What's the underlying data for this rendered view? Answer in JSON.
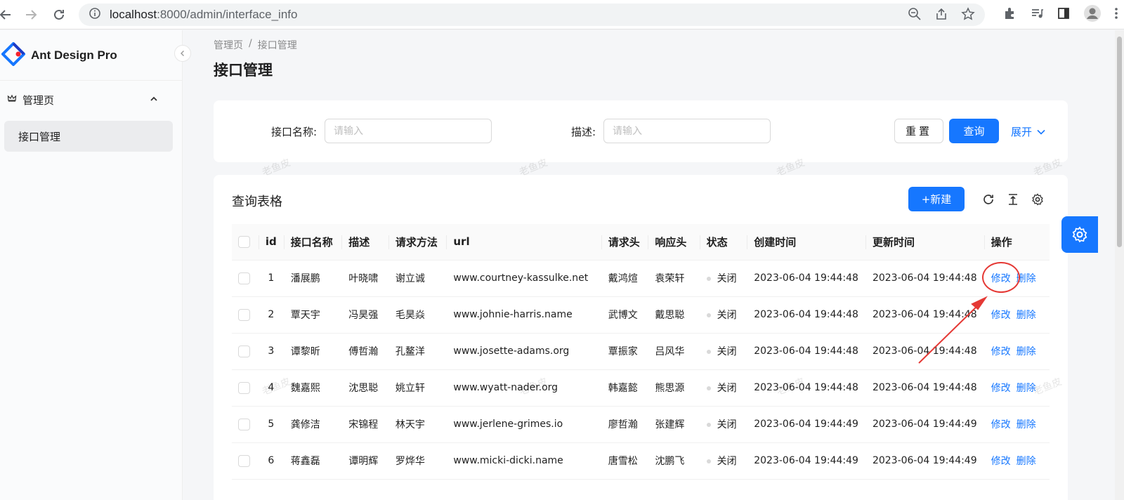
{
  "browser": {
    "url_host": "localhost",
    "url_path": ":8000/admin/interface_info"
  },
  "sidebar": {
    "logo_text": "Ant Design Pro",
    "group_label": "管理页",
    "items": [
      {
        "label": "接口管理"
      }
    ]
  },
  "breadcrumb": {
    "items": [
      "管理页",
      "接口管理"
    ],
    "separator": "/"
  },
  "page_title": "接口管理",
  "search": {
    "name_label": "接口名称:",
    "name_placeholder": "请输入",
    "desc_label": "描述:",
    "desc_placeholder": "请输入",
    "reset_label": "重置",
    "query_label": "查询",
    "expand_label": "展开"
  },
  "table": {
    "title": "查询表格",
    "new_label": "+新建",
    "columns": [
      "id",
      "接口名称",
      "描述",
      "请求方法",
      "url",
      "请求头",
      "响应头",
      "状态",
      "创建时间",
      "更新时间",
      "操作"
    ],
    "rows": [
      {
        "id": "1",
        "name": "潘展鹏",
        "desc": "叶晓啸",
        "method": "谢立诚",
        "url": "www.courtney-kassulke.net",
        "req": "戴鸿煊",
        "resp": "袁荣轩",
        "status": "关闭",
        "created": "2023-06-04 19:44:48",
        "updated": "2023-06-04 19:44:48",
        "edit": "修改",
        "del": "删除"
      },
      {
        "id": "2",
        "name": "覃天宇",
        "desc": "冯昊强",
        "method": "毛昊焱",
        "url": "www.johnie-harris.name",
        "req": "武博文",
        "resp": "戴思聪",
        "status": "关闭",
        "created": "2023-06-04 19:44:48",
        "updated": "2023-06-04 19:44:48",
        "edit": "修改",
        "del": "删除"
      },
      {
        "id": "3",
        "name": "谭黎昕",
        "desc": "傅哲瀚",
        "method": "孔鳌洋",
        "url": "www.josette-adams.org",
        "req": "覃振家",
        "resp": "吕风华",
        "status": "关闭",
        "created": "2023-06-04 19:44:48",
        "updated": "2023-06-04 19:44:48",
        "edit": "修改",
        "del": "删除"
      },
      {
        "id": "4",
        "name": "魏嘉熙",
        "desc": "沈思聪",
        "method": "姚立轩",
        "url": "www.wyatt-nader.org",
        "req": "韩嘉懿",
        "resp": "熊思源",
        "status": "关闭",
        "created": "2023-06-04 19:44:48",
        "updated": "2023-06-04 19:44:48",
        "edit": "修改",
        "del": "删除"
      },
      {
        "id": "5",
        "name": "龚修洁",
        "desc": "宋锦程",
        "method": "林天宇",
        "url": "www.jerlene-grimes.io",
        "req": "廖哲瀚",
        "resp": "张建辉",
        "status": "关闭",
        "created": "2023-06-04 19:44:49",
        "updated": "2023-06-04 19:44:49",
        "edit": "修改",
        "del": "删除"
      },
      {
        "id": "6",
        "name": "蒋鑫磊",
        "desc": "谭明辉",
        "method": "罗烨华",
        "url": "www.micki-dicki.name",
        "req": "唐雪松",
        "resp": "沈鹏飞",
        "status": "关闭",
        "created": "2023-06-04 19:44:49",
        "updated": "2023-06-04 19:44:49",
        "edit": "修改",
        "del": "删除"
      }
    ]
  },
  "watermark_text": "老鱼皮",
  "colors": {
    "primary": "#1677ff",
    "annotation": "#e53935"
  }
}
